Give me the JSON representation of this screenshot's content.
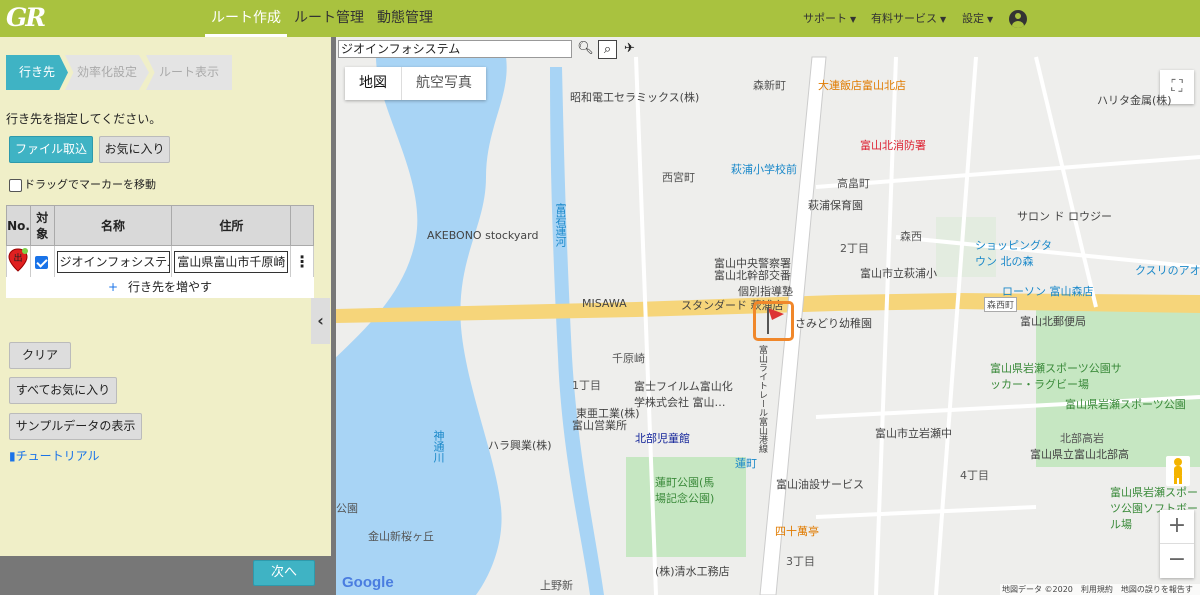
{
  "app": {
    "logo": "GR"
  },
  "nav": {
    "items": [
      {
        "label": "ルート作成",
        "active": true
      },
      {
        "label": "ルート管理",
        "active": false
      },
      {
        "label": "動態管理",
        "active": false
      }
    ],
    "right_menu": [
      {
        "label": "サポート"
      },
      {
        "label": "有料サービス"
      },
      {
        "label": "設定"
      }
    ]
  },
  "steps": [
    {
      "label": "行き先",
      "active": true
    },
    {
      "label": "効率化設定",
      "active": false
    },
    {
      "label": "ルート表示",
      "active": false
    }
  ],
  "panel": {
    "instruction": "行き先を指定してください。",
    "file_import_label": "ファイル取込",
    "favorite_label": "お気に入り",
    "drag_marker_label": "ドラッグでマーカーを移動",
    "drag_marker_checked": false,
    "table": {
      "headers": {
        "no": "No.",
        "target": "対象",
        "name": "名称",
        "address": "住所"
      },
      "rows": [
        {
          "pin_label": "出",
          "checked": true,
          "name": "ジオインフォシステム",
          "address": "富山県富山市千原崎"
        }
      ],
      "add_row_icon": "+",
      "add_row_label": "行き先を増やす"
    },
    "clear_label": "クリア",
    "all_favorites_label": "すべてお気に入り",
    "sample_data_label": "サンプルデータの表示",
    "tutorial_label": "チュートリアル",
    "next_label": "次へ"
  },
  "map": {
    "search_value": "ジオインフォシステム",
    "map_type": {
      "map": "地図",
      "satellite": "航空写真"
    },
    "attribution": "地図データ ©2020　利用規約　地図の誤りを報告する",
    "google_logo": "Google",
    "zoom_in": "+",
    "zoom_out": "−",
    "labels": [
      "昭和電工セラミックス(株)",
      "萩浦小学校前",
      "大連飯店富山北店",
      "富山北消防署",
      "西宮町",
      "高畠町",
      "萩浦保育園",
      "AKEBONO stockyard",
      "富岩運河",
      "富山中央警察署",
      "富山北幹部交番",
      "個別指導塾",
      "富山市立萩浦小",
      "ショッピングタウン 北の森",
      "MISAWA",
      "スタンダード 萩浦店",
      "さみどり幼稚園",
      "ローソン 富山森店",
      "富山北郵便局",
      "千原崎",
      "富士フイルム富山化学株式会社 富山…",
      "東亜工業(株)",
      "富山営業所",
      "北部児童館",
      "蓮町",
      "ハラ興業(株)",
      "神通川",
      "蓮町公園(馬場記念公園)",
      "富山油設サービス",
      "四十萬亭",
      "(株)清水工務店",
      "金山新桜ヶ丘",
      "上野新",
      "富山県岩瀬スポーツ公園サッカー・ラグビー場",
      "富山県岩瀬スポーツ公園",
      "富山市立岩瀬中",
      "富山県立富山北部高",
      "クスリのアオキ",
      "サロン ド ロウジー",
      "ハリタ金属(株)",
      "森西",
      "森西町",
      "1丁目",
      "2丁目",
      "3丁目",
      "4丁目",
      "北部高岩",
      "富山県岩瀬スポーツ公園ソフトボール場",
      "公園",
      "富山ライトレール富山港線",
      "森新町"
    ]
  }
}
